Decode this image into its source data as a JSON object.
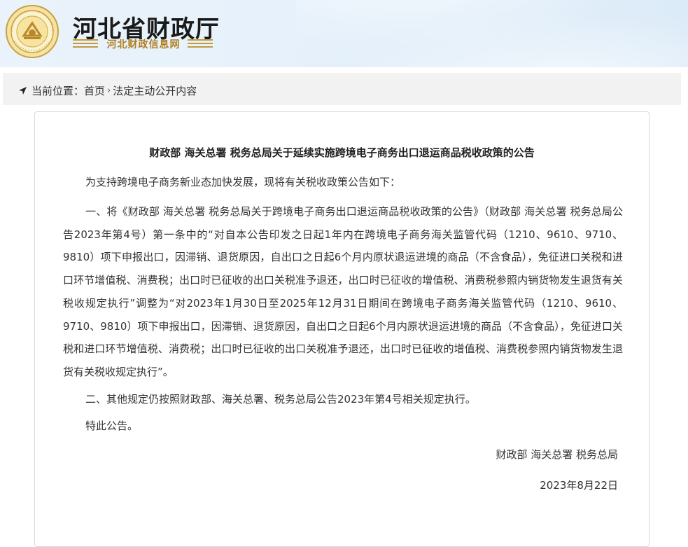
{
  "header": {
    "site_title": "河北省财政厅",
    "site_subtitle": "河北财政信息网"
  },
  "breadcrumb": {
    "label": "当前位置：",
    "home": "首页",
    "separator": "›",
    "current": "法定主动公开内容"
  },
  "article": {
    "title": "财政部 海关总署 税务总局关于延续实施跨境电子商务出口退运商品税收政策的公告",
    "intro": "为支持跨境电子商务新业态加快发展，现将有关税收政策公告如下：",
    "item1": "一、将《财政部 海关总署 税务总局关于跨境电子商务出口退运商品税收政策的公告》（财政部 海关总署 税务总局公告2023年第4号）第一条中的“对自本公告印发之日起1年内在跨境电子商务海关监管代码（1210、9610、9710、9810）项下申报出口，因滞销、退货原因，自出口之日起6个月内原状退运进境的商品（不含食品），免征进口关税和进口环节增值税、消费税；出口时已征收的出口关税准予退还，出口时已征收的增值税、消费税参照内销货物发生退货有关税收规定执行”调整为“对2023年1月30日至2025年12月31日期间在跨境电子商务海关监管代码（1210、9610、9710、9810）项下申报出口，因滞销、退货原因，自出口之日起6个月内原状退运进境的商品（不含食品），免征进口关税和进口环节增值税、消费税；出口时已征收的出口关税准予退还，出口时已征收的增值税、消费税参照内销货物发生退货有关税收规定执行”。",
    "item2": "二、其他规定仍按照财政部、海关总署、税务总局公告2023年第4号相关规定执行。",
    "closing": "特此公告。",
    "signature": "财政部 海关总署 税务总局",
    "date": "2023年8月22日"
  },
  "colors": {
    "header_bg": "#e6f1fb",
    "crumb_bg": "#f2f2f2",
    "brand_gold": "#b07d1e",
    "border": "#d8d8d8"
  },
  "icons": {
    "logo": "hebei-finance-seal-icon",
    "location": "location-arrow-icon"
  }
}
